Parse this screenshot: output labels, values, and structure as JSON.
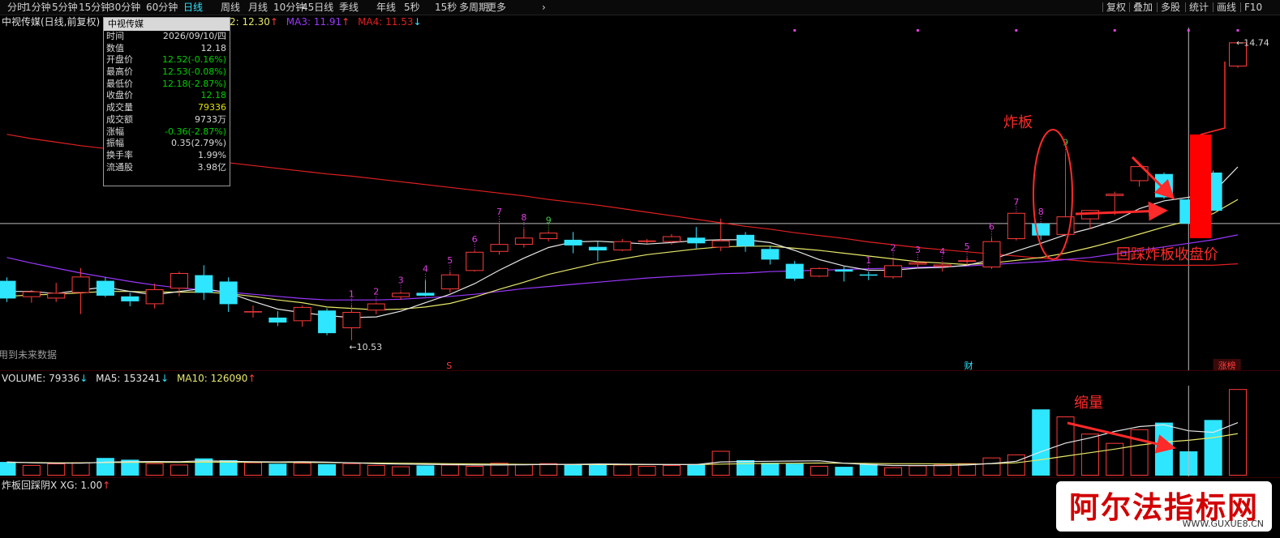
{
  "toolbar": {
    "left_items": [
      "分时",
      "1分钟",
      "5分钟",
      "15分钟",
      "30分钟",
      "60分钟",
      "日线",
      "周线",
      "月线",
      "10分钟",
      "45日线",
      "季线",
      "年线",
      "5秒",
      "15秒",
      "多周期",
      "更多"
    ],
    "active": "日线",
    "more_arrow": "›",
    "right_items": [
      "复权",
      "叠加",
      "多股",
      "统计",
      "画线",
      "F10"
    ]
  },
  "main_legend": {
    "title": "中视传媒(日线,前复权)",
    "ma2": "2: 12.30",
    "ma2_arrow": "↑",
    "ma3": "MA3: 11.91",
    "ma3_arrow": "↑",
    "ma4": "MA4: 11.53",
    "ma4_arrow": "↓"
  },
  "infobox": {
    "title": "中视传媒",
    "rows": [
      {
        "label": "时间",
        "value": "2026/09/10/四",
        "tone": "white"
      },
      {
        "label": "数值",
        "value": "12.18",
        "tone": "white"
      },
      {
        "label": "开盘价",
        "value": "12.52(-0.16%)",
        "tone": "green"
      },
      {
        "label": "最高价",
        "value": "12.53(-0.08%)",
        "tone": "green"
      },
      {
        "label": "最低价",
        "value": "12.18(-2.87%)",
        "tone": "green"
      },
      {
        "label": "收盘价",
        "value": "12.18",
        "tone": "green"
      },
      {
        "label": "成交量",
        "value": "79336",
        "tone": "yellow"
      },
      {
        "label": "成交额",
        "value": "9733万",
        "tone": "white"
      },
      {
        "label": "涨幅",
        "value": "-0.36(-2.87%)",
        "tone": "green"
      },
      {
        "label": "振幅",
        "value": "0.35(2.79%)",
        "tone": "white"
      },
      {
        "label": "换手率",
        "value": "1.99%",
        "tone": "white"
      },
      {
        "label": "流通股",
        "value": "3.98亿",
        "tone": "white"
      }
    ]
  },
  "notes": {
    "future_data": "用到未来数据",
    "low_label": "←10.53",
    "high_label": "←14.74",
    "marker_s": "S",
    "marker_cai": "财",
    "marker_zhangbang": "涨榜"
  },
  "annotations": {
    "zhaban": "炸板",
    "huicai": "回踩炸板收盘价",
    "suoliang": "缩量"
  },
  "volume_legend": {
    "volume": "VOLUME: 79336",
    "volume_arrow": "↓",
    "ma5": "MA5: 153241",
    "ma5_arrow": "↓",
    "ma10": "MA10: 126090",
    "ma10_arrow": "↑"
  },
  "indicator_legend": {
    "label": "炸板回踩阴X XG: 1.00",
    "arrow": "↑"
  },
  "watermark": {
    "title": "阿尔法指标网",
    "url": "WWW.GUXUE8.CN"
  },
  "colors": {
    "up": "#ff3b3b",
    "down": "#2ee6ff",
    "ma_white": "#e6e6e6",
    "ma_yellow": "#e8e86a",
    "ma_purple": "#9b38ff",
    "ma_red": "#e02020",
    "annot": "#ff2a2a",
    "seq_magenta": "#e040e0",
    "seq_green": "#40d040"
  },
  "chart_data": {
    "type": "candlestick",
    "price_range": [
      10.3,
      14.95
    ],
    "crosshair_price": 12.18,
    "candles": [
      {
        "o": 11.37,
        "h": 11.42,
        "l": 11.07,
        "c": 11.12
      },
      {
        "o": 11.14,
        "h": 11.24,
        "l": 11.06,
        "c": 11.22
      },
      {
        "o": 11.12,
        "h": 11.34,
        "l": 11.07,
        "c": 11.2
      },
      {
        "o": 11.2,
        "h": 11.55,
        "l": 10.9,
        "c": 11.43
      },
      {
        "o": 11.37,
        "h": 11.42,
        "l": 11.14,
        "c": 11.16
      },
      {
        "o": 11.15,
        "h": 11.2,
        "l": 11.01,
        "c": 11.08
      },
      {
        "o": 11.04,
        "h": 11.33,
        "l": 10.98,
        "c": 11.25
      },
      {
        "o": 11.26,
        "h": 11.5,
        "l": 11.15,
        "c": 11.48
      },
      {
        "o": 11.45,
        "h": 11.59,
        "l": 11.1,
        "c": 11.2
      },
      {
        "o": 11.36,
        "h": 11.42,
        "l": 10.93,
        "c": 11.04
      },
      {
        "o": 10.93,
        "h": 11.02,
        "l": 10.85,
        "c": 10.94
      },
      {
        "o": 10.85,
        "h": 10.94,
        "l": 10.73,
        "c": 10.78
      },
      {
        "o": 10.8,
        "h": 11.02,
        "l": 10.72,
        "c": 11.0
      },
      {
        "o": 10.95,
        "h": 10.98,
        "l": 10.6,
        "c": 10.63
      },
      {
        "o": 10.7,
        "h": 11.03,
        "l": 10.53,
        "c": 10.93
      },
      {
        "o": 10.95,
        "h": 11.06,
        "l": 10.9,
        "c": 11.05
      },
      {
        "o": 11.14,
        "h": 11.22,
        "l": 11.1,
        "c": 11.2
      },
      {
        "o": 11.2,
        "h": 11.38,
        "l": 11.15,
        "c": 11.16
      },
      {
        "o": 11.25,
        "h": 11.5,
        "l": 11.2,
        "c": 11.46
      },
      {
        "o": 11.51,
        "h": 11.8,
        "l": 11.5,
        "c": 11.78
      },
      {
        "o": 11.78,
        "h": 12.19,
        "l": 11.74,
        "c": 11.89
      },
      {
        "o": 11.88,
        "h": 12.11,
        "l": 11.84,
        "c": 11.98
      },
      {
        "o": 11.96,
        "h": 12.07,
        "l": 11.93,
        "c": 12.05
      },
      {
        "o": 11.95,
        "h": 12.06,
        "l": 11.76,
        "c": 11.87
      },
      {
        "o": 11.85,
        "h": 11.93,
        "l": 11.65,
        "c": 11.8
      },
      {
        "o": 11.8,
        "h": 11.96,
        "l": 11.79,
        "c": 11.93
      },
      {
        "o": 11.92,
        "h": 11.96,
        "l": 11.9,
        "c": 11.94
      },
      {
        "o": 11.92,
        "h": 12.03,
        "l": 11.88,
        "c": 12.0
      },
      {
        "o": 11.98,
        "h": 12.13,
        "l": 11.83,
        "c": 11.9
      },
      {
        "o": 11.84,
        "h": 12.25,
        "l": 11.79,
        "c": 11.94
      },
      {
        "o": 12.02,
        "h": 12.06,
        "l": 11.78,
        "c": 11.86
      },
      {
        "o": 11.82,
        "h": 11.86,
        "l": 11.6,
        "c": 11.67
      },
      {
        "o": 11.61,
        "h": 11.65,
        "l": 11.37,
        "c": 11.4
      },
      {
        "o": 11.43,
        "h": 11.56,
        "l": 11.42,
        "c": 11.55
      },
      {
        "o": 11.53,
        "h": 11.57,
        "l": 11.36,
        "c": 11.5
      },
      {
        "o": 11.46,
        "h": 11.5,
        "l": 11.38,
        "c": 11.45
      },
      {
        "o": 11.42,
        "h": 11.68,
        "l": 11.4,
        "c": 11.59
      },
      {
        "o": 11.6,
        "h": 11.65,
        "l": 11.55,
        "c": 11.63
      },
      {
        "o": 11.57,
        "h": 11.63,
        "l": 11.5,
        "c": 11.6
      },
      {
        "o": 11.64,
        "h": 11.7,
        "l": 11.59,
        "c": 11.66
      },
      {
        "o": 11.56,
        "h": 11.98,
        "l": 11.54,
        "c": 11.93
      },
      {
        "o": 11.96,
        "h": 12.33,
        "l": 11.94,
        "c": 12.33
      },
      {
        "o": 12.18,
        "h": 12.19,
        "l": 11.95,
        "c": 12.01
      },
      {
        "o": 12.02,
        "h": 13.17,
        "l": 12.0,
        "c": 12.28
      },
      {
        "o": 12.24,
        "h": 12.35,
        "l": 12.1,
        "c": 12.37
      },
      {
        "o": 12.57,
        "h": 12.63,
        "l": 12.3,
        "c": 12.6
      },
      {
        "o": 12.78,
        "h": 13.03,
        "l": 12.7,
        "c": 12.99
      },
      {
        "o": 12.88,
        "h": 12.9,
        "l": 12.53,
        "c": 12.55
      },
      {
        "o": 12.52,
        "h": 12.53,
        "l": 12.18,
        "c": 12.18
      },
      {
        "o": 12.9,
        "h": 12.93,
        "l": 12.36,
        "c": 12.36
      },
      {
        "o": 14.4,
        "h": 14.74,
        "l": 14.38,
        "c": 14.74
      }
    ],
    "ma_white": [
      11.22,
      11.22,
      11.19,
      11.24,
      11.28,
      11.22,
      11.17,
      11.22,
      11.26,
      11.2,
      11.08,
      10.97,
      10.92,
      10.88,
      10.85,
      10.86,
      10.94,
      11.06,
      11.18,
      11.33,
      11.52,
      11.69,
      11.84,
      11.92,
      11.93,
      11.91,
      11.89,
      11.91,
      11.94,
      11.95,
      11.95,
      11.91,
      11.8,
      11.67,
      11.58,
      11.52,
      11.52,
      11.55,
      11.56,
      11.59,
      11.67,
      11.79,
      11.9,
      12.02,
      12.11,
      12.22,
      12.39,
      12.5,
      12.55,
      12.62,
      12.98
    ],
    "ma_yellow": [
      11.15,
      11.17,
      11.18,
      11.2,
      11.22,
      11.22,
      11.21,
      11.21,
      11.21,
      11.19,
      11.15,
      11.1,
      11.06,
      11.0,
      10.98,
      10.96,
      10.97,
      11.0,
      11.05,
      11.14,
      11.25,
      11.35,
      11.46,
      11.54,
      11.62,
      11.68,
      11.74,
      11.78,
      11.82,
      11.85,
      11.86,
      11.86,
      11.83,
      11.8,
      11.76,
      11.72,
      11.68,
      11.64,
      11.62,
      11.6,
      11.62,
      11.66,
      11.7,
      11.76,
      11.84,
      11.93,
      12.03,
      12.13,
      12.22,
      12.32,
      12.52
    ],
    "ma_purple": [
      11.7,
      11.62,
      11.55,
      11.48,
      11.42,
      11.36,
      11.31,
      11.27,
      11.24,
      11.21,
      11.18,
      11.15,
      11.12,
      11.1,
      11.1,
      11.1,
      11.11,
      11.13,
      11.15,
      11.18,
      11.22,
      11.26,
      11.29,
      11.32,
      11.35,
      11.38,
      11.41,
      11.43,
      11.45,
      11.47,
      11.48,
      11.5,
      11.51,
      11.52,
      11.53,
      11.54,
      11.55,
      11.56,
      11.57,
      11.58,
      11.6,
      11.62,
      11.64,
      11.67,
      11.7,
      11.75,
      11.8,
      11.85,
      11.9,
      11.95,
      12.02
    ],
    "ma_red": [
      13.44,
      13.38,
      13.33,
      13.28,
      13.24,
      13.2,
      13.16,
      13.12,
      13.08,
      13.04,
      13.0,
      12.96,
      12.92,
      12.88,
      12.85,
      12.81,
      12.77,
      12.73,
      12.69,
      12.65,
      12.61,
      12.57,
      12.52,
      12.48,
      12.44,
      12.39,
      12.34,
      12.29,
      12.24,
      12.19,
      12.14,
      12.1,
      12.05,
      12.01,
      11.97,
      11.92,
      11.88,
      11.84,
      11.81,
      11.78,
      11.75,
      11.72,
      11.69,
      11.67,
      11.64,
      11.62,
      11.6,
      11.59,
      11.59,
      11.59,
      11.61
    ],
    "sequence_labels": [
      {
        "i": 14,
        "t": "1",
        "color": "magenta"
      },
      {
        "i": 15,
        "t": "2",
        "color": "magenta"
      },
      {
        "i": 16,
        "t": "3",
        "color": "magenta"
      },
      {
        "i": 17,
        "t": "4",
        "color": "magenta"
      },
      {
        "i": 18,
        "t": "5",
        "color": "magenta"
      },
      {
        "i": 19,
        "t": "6",
        "color": "magenta"
      },
      {
        "i": 20,
        "t": "7",
        "color": "magenta"
      },
      {
        "i": 21,
        "t": "8",
        "color": "magenta"
      },
      {
        "i": 22,
        "t": "9",
        "color": "green"
      },
      {
        "i": 35,
        "t": "1",
        "color": "magenta"
      },
      {
        "i": 36,
        "t": "2",
        "color": "magenta"
      },
      {
        "i": 37,
        "t": "3",
        "color": "magenta"
      },
      {
        "i": 38,
        "t": "4",
        "color": "magenta"
      },
      {
        "i": 39,
        "t": "5",
        "color": "magenta"
      },
      {
        "i": 40,
        "t": "6",
        "color": "magenta"
      },
      {
        "i": 41,
        "t": "7",
        "color": "magenta"
      },
      {
        "i": 42,
        "t": "8",
        "color": "magenta"
      },
      {
        "i": 43,
        "t": "9",
        "color": "green"
      }
    ],
    "volume": {
      "range": [
        0,
        400000
      ],
      "values": [
        62000,
        48000,
        55000,
        60000,
        80000,
        72000,
        56000,
        50000,
        78000,
        70000,
        60000,
        54000,
        58000,
        52000,
        56000,
        48000,
        42000,
        46000,
        50000,
        44000,
        58000,
        52000,
        56000,
        48000,
        52000,
        50000,
        44000,
        48000,
        52000,
        112000,
        70000,
        58000,
        54000,
        44000,
        40000,
        52000,
        38000,
        46000,
        50000,
        56000,
        82000,
        96000,
        300000,
        268000,
        190000,
        148000,
        210000,
        240000,
        110000,
        252000,
        392000
      ],
      "ma_white": [
        62000,
        58000,
        56000,
        56000,
        61000,
        63000,
        64000,
        63000,
        67000,
        65000,
        63000,
        62000,
        63000,
        61000,
        58000,
        54000,
        52000,
        51000,
        50000,
        48000,
        48000,
        49000,
        51000,
        51000,
        53000,
        52000,
        51000,
        50000,
        50000,
        62000,
        64000,
        65000,
        66000,
        67000,
        56000,
        50000,
        46000,
        46000,
        45000,
        48000,
        55000,
        65000,
        108000,
        147000,
        171000,
        200000,
        222000,
        230000,
        203000,
        196000,
        240000
      ],
      "ma_yellow": [
        60000,
        59000,
        58000,
        58000,
        59000,
        60000,
        60000,
        60000,
        61000,
        61000,
        61000,
        60000,
        60000,
        59000,
        58000,
        57000,
        56000,
        55000,
        54000,
        53000,
        52000,
        51000,
        51000,
        50000,
        50000,
        50000,
        50000,
        50000,
        50000,
        52000,
        54000,
        55000,
        56000,
        57000,
        56000,
        55000,
        54000,
        54000,
        53000,
        52000,
        54000,
        58000,
        72000,
        88000,
        104000,
        120000,
        138000,
        152000,
        160000,
        172000,
        190000
      ]
    }
  }
}
